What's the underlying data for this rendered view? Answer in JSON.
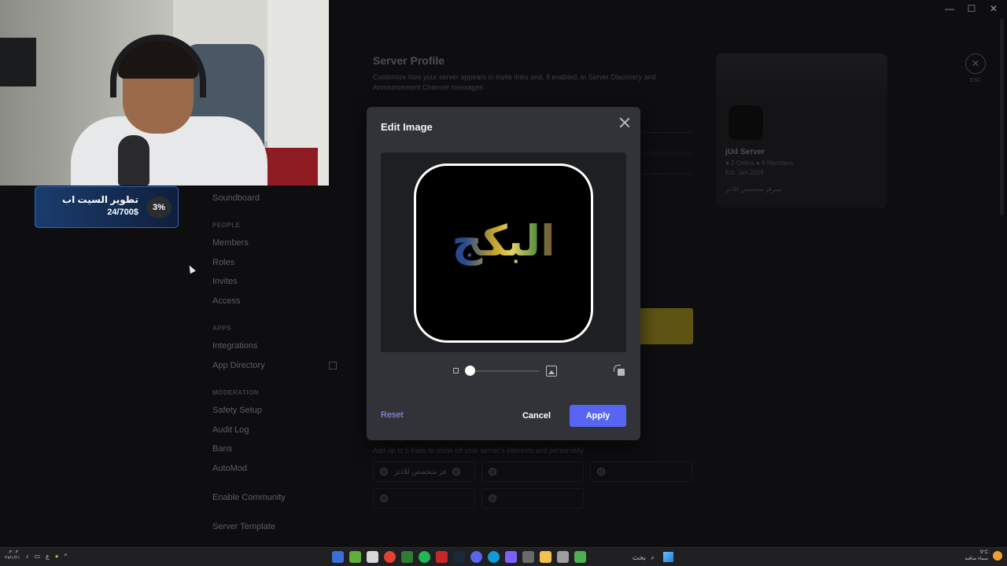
{
  "window": {
    "minimize": "—",
    "maximize": "☐",
    "close": "✕"
  },
  "settings_nav": {
    "soundboard": "Soundboard",
    "people_header": "PEOPLE",
    "members": "Members",
    "roles": "Roles",
    "invites": "Invites",
    "access": "Access",
    "apps_header": "APPS",
    "integrations": "Integrations",
    "app_directory": "App Directory",
    "moderation_header": "MODERATION",
    "safety_setup": "Safety Setup",
    "audit_log": "Audit Log",
    "bans": "Bans",
    "automod": "AutoMod",
    "enable_community": "Enable Community",
    "server_template": "Server Template"
  },
  "server_profile": {
    "title": "Server Profile",
    "description": "Customize how your server appears in invite links and, if enabled, in Server Discovery and Announcement Channel messages",
    "traits_description": "Add up to 5 traits to show off your server's interests and personality.",
    "trait_1": "فر متخصص للاذتر"
  },
  "preview_card": {
    "server_name": "jUd Server",
    "stats": "● 2 Online  ● 9 Members",
    "established": "Est. Jan 2026",
    "tagline": "سيرفر متخصص للاذتر"
  },
  "esc": {
    "icon": "✕",
    "label": "ESC"
  },
  "donation_widget": {
    "title": "تطوير السيت اب",
    "amount": "24/700$",
    "percent": "3%"
  },
  "modal": {
    "title": "Edit Image",
    "logo_text": "البكج",
    "reset": "Reset",
    "cancel": "Cancel",
    "apply": "Apply",
    "zoom_level": 0
  },
  "taskbar": {
    "clock_time": "٠٣:٠٣",
    "clock_date": "٢٧/١/٢١",
    "lang": "ع",
    "search_label": "بحث",
    "weather_temp": "9°C",
    "weather_desc": "سماء صافية"
  },
  "colors": {
    "accent": "#5865f2",
    "link": "#949cf7",
    "modal_bg": "#313338",
    "donation_border": "#3066b3"
  }
}
